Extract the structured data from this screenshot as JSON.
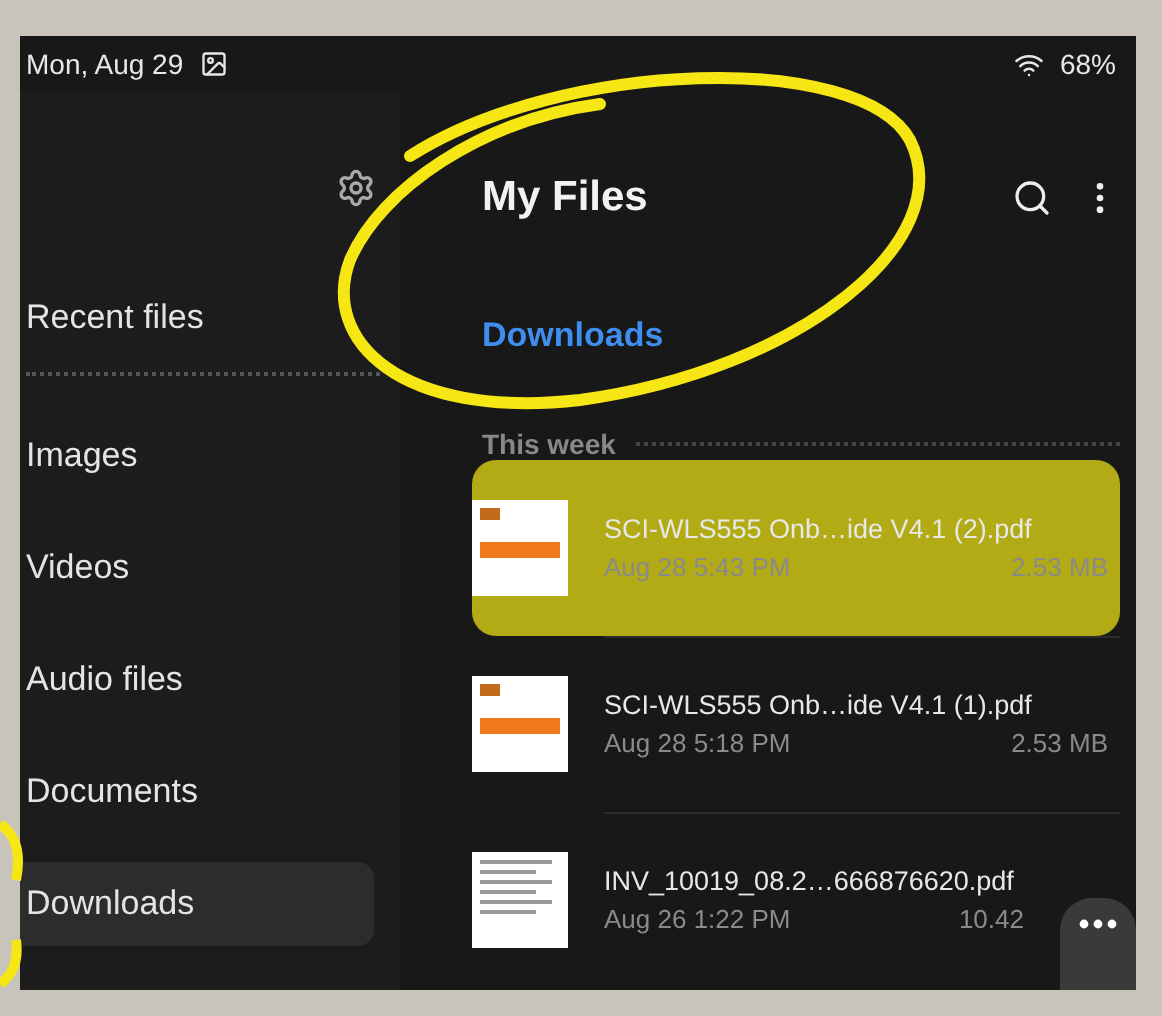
{
  "status_bar": {
    "date": "Mon, Aug 29",
    "battery": "68%"
  },
  "sidebar": {
    "items": [
      {
        "label": "Recent files",
        "selected": false,
        "divider_after": true
      },
      {
        "label": "Images",
        "selected": false,
        "divider_after": false
      },
      {
        "label": "Videos",
        "selected": false,
        "divider_after": false
      },
      {
        "label": "Audio files",
        "selected": false,
        "divider_after": false
      },
      {
        "label": "Documents",
        "selected": false,
        "divider_after": false
      },
      {
        "label": "Downloads",
        "selected": true,
        "divider_after": false
      }
    ]
  },
  "header": {
    "title": "My Files",
    "breadcrumb": "Downloads"
  },
  "section": {
    "title": "This week"
  },
  "files": [
    {
      "name": "SCI-WLS555 Onb…ide V4.1 (2).pdf",
      "date": "Aug 28 5:43 PM",
      "size": "2.53 MB",
      "kind": "brochure",
      "highlighted": true
    },
    {
      "name": "SCI-WLS555 Onb…ide V4.1 (1).pdf",
      "date": "Aug 28 5:18 PM",
      "size": "2.53 MB",
      "kind": "brochure",
      "highlighted": false
    },
    {
      "name": "INV_10019_08.2…666876620.pdf",
      "date": "Aug 26 1:22 PM",
      "size": "10.42",
      "kind": "invoice",
      "highlighted": false
    }
  ]
}
